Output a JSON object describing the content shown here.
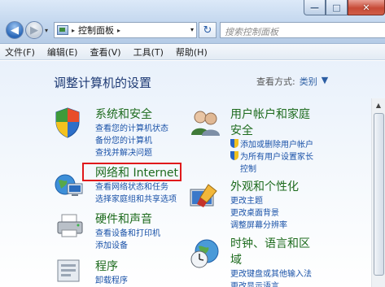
{
  "window": {
    "minimize_glyph": "—",
    "maximize_glyph": "□",
    "close_glyph": "✕"
  },
  "nav": {
    "back_glyph": "◀",
    "forward_glyph": "▶",
    "dropdown_glyph": "▾"
  },
  "address": {
    "crumb": "控制面板",
    "separator": "▸",
    "dropdown_glyph": "▾",
    "refresh_glyph": "↻"
  },
  "search": {
    "placeholder": "搜索控制面板"
  },
  "menu": {
    "file": "文件(F)",
    "edit": "编辑(E)",
    "view": "查看(V)",
    "tools": "工具(T)",
    "help": "帮助(H)"
  },
  "page": {
    "heading": "调整计算机的设置",
    "view_by_label": "查看方式:",
    "view_by_value": "类别",
    "view_by_glyph": "▼"
  },
  "categories": {
    "system": {
      "title": "系统和安全",
      "links": [
        "查看您的计算机状态",
        "备份您的计算机",
        "查找并解决问题"
      ]
    },
    "network": {
      "title": "网络和 Internet",
      "links": [
        "查看网络状态和任务",
        "选择家庭组和共享选项"
      ]
    },
    "hardware": {
      "title": "硬件和声音",
      "links": [
        "查看设备和打印机",
        "添加设备"
      ]
    },
    "programs": {
      "title": "程序",
      "links": [
        "卸载程序"
      ]
    },
    "users": {
      "title_line1": "用户帐户和家庭",
      "title_line2": "安全",
      "links": [
        "添加或删除用户帐户",
        "为所有用户设置家长",
        "控制"
      ]
    },
    "appearance": {
      "title": "外观和个性化",
      "links": [
        "更改主题",
        "更改桌面背景",
        "调整屏幕分辨率"
      ]
    },
    "clock": {
      "title_line1": "时钟、语言和区",
      "title_line2": "域",
      "links": [
        "更改键盘或其他输入法",
        "更改显示语言"
      ]
    }
  },
  "scrollbar": {
    "up_glyph": "▲"
  }
}
